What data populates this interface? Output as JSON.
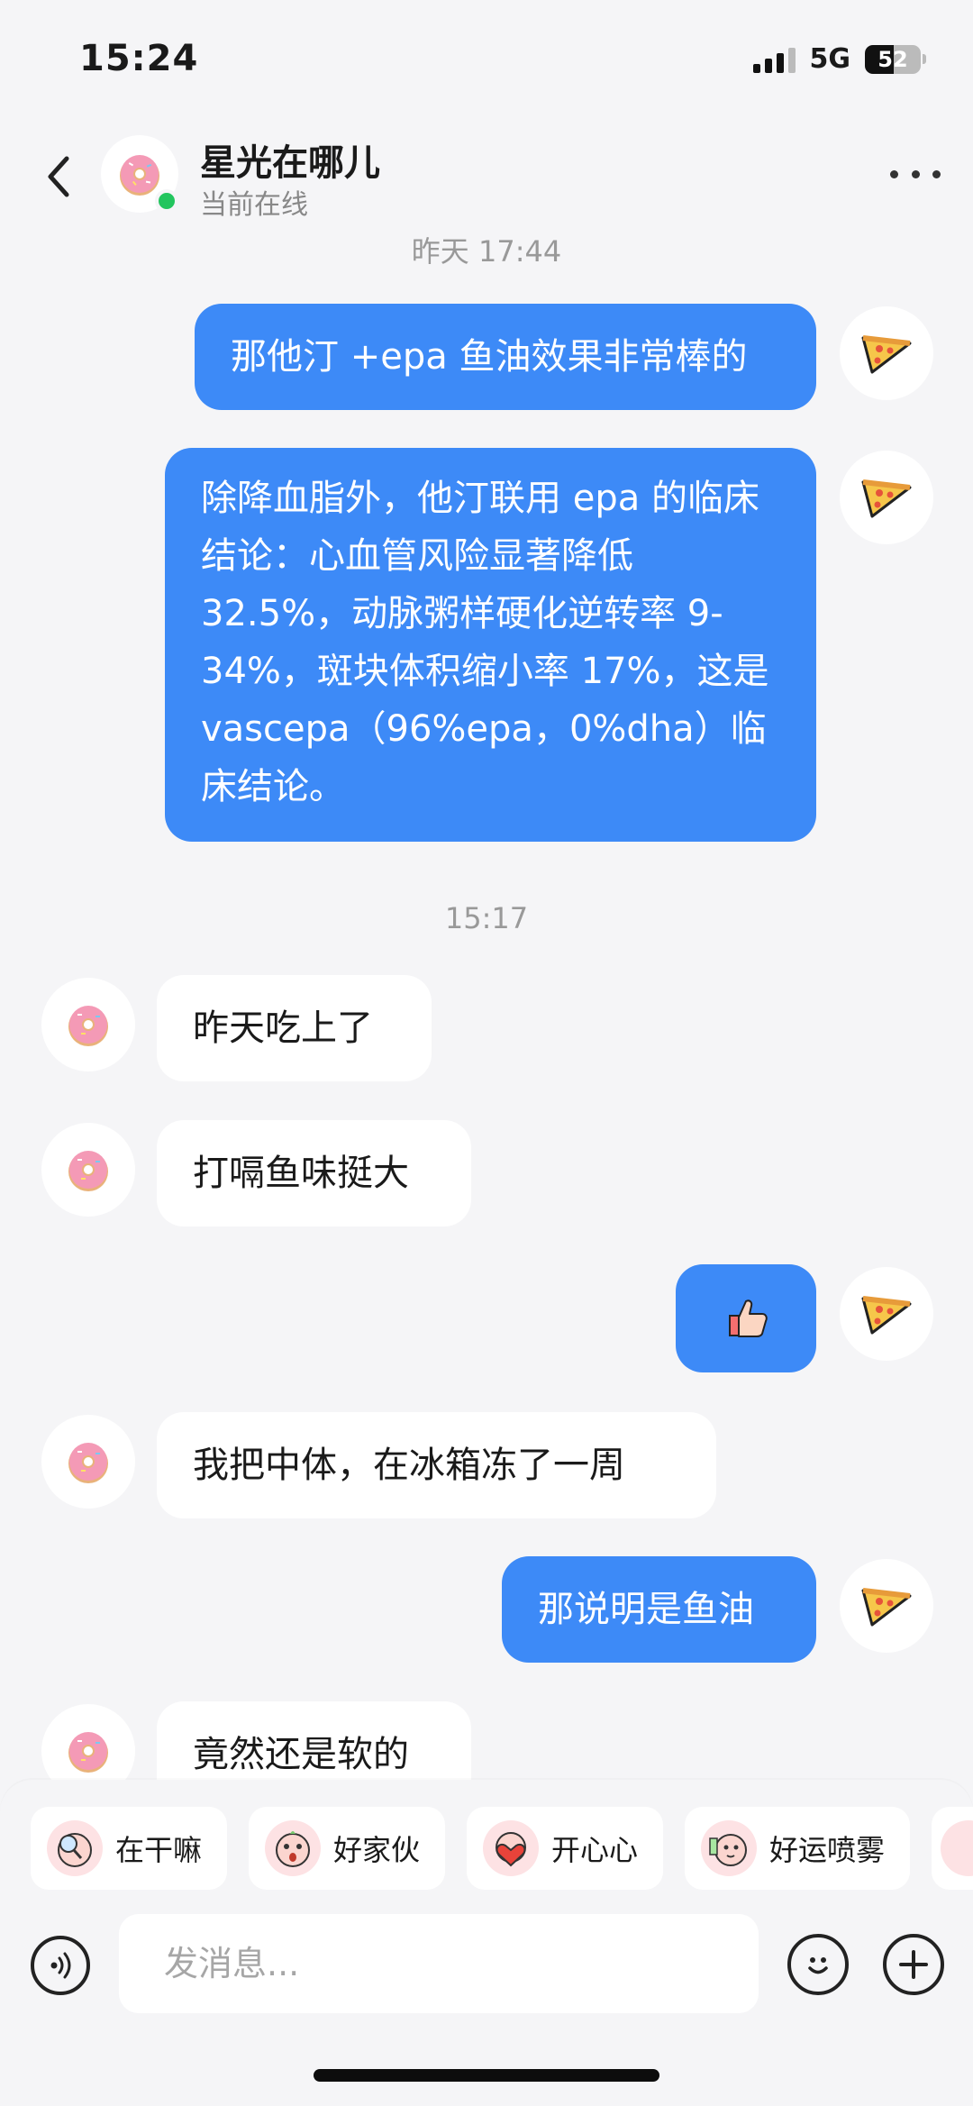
{
  "status_bar": {
    "time": "15:24",
    "network": "5G",
    "battery": "52"
  },
  "header": {
    "name": "星光在哪儿",
    "status": "当前在线"
  },
  "timestamps": [
    "昨天 17:44",
    "15:17"
  ],
  "messages": [
    {
      "dir": "out",
      "text": "那他汀 +epa 鱼油效果非常棒的"
    },
    {
      "dir": "out",
      "text": "除降血脂外，他汀联用 epa 的临床结论：心血管风险显著降低 32.5%，动脉粥样硬化逆转率 9-34%，斑块体积缩小率 17%，这是 vascepa（96%epa，0%dha）临床结论。"
    },
    {
      "dir": "in",
      "text": "昨天吃上了"
    },
    {
      "dir": "in",
      "text": "打嗝鱼味挺大"
    },
    {
      "dir": "out",
      "text": "",
      "sticker": "thumbs-up"
    },
    {
      "dir": "in",
      "text": "我把中体，在冰箱冻了一周"
    },
    {
      "dir": "out",
      "text": "那说明是鱼油"
    },
    {
      "dir": "in",
      "text": "竟然还是软的"
    }
  ],
  "quick_replies": [
    "在干嘛",
    "好家伙",
    "开心心",
    "好运喷雾"
  ],
  "input": {
    "placeholder": "发消息..."
  },
  "colors": {
    "accent": "#3d8af7",
    "online": "#22c55e",
    "background": "#f5f5f7"
  },
  "icons": {
    "contact_avatar": "donut-icon",
    "my_avatar": "pizza-icon"
  }
}
